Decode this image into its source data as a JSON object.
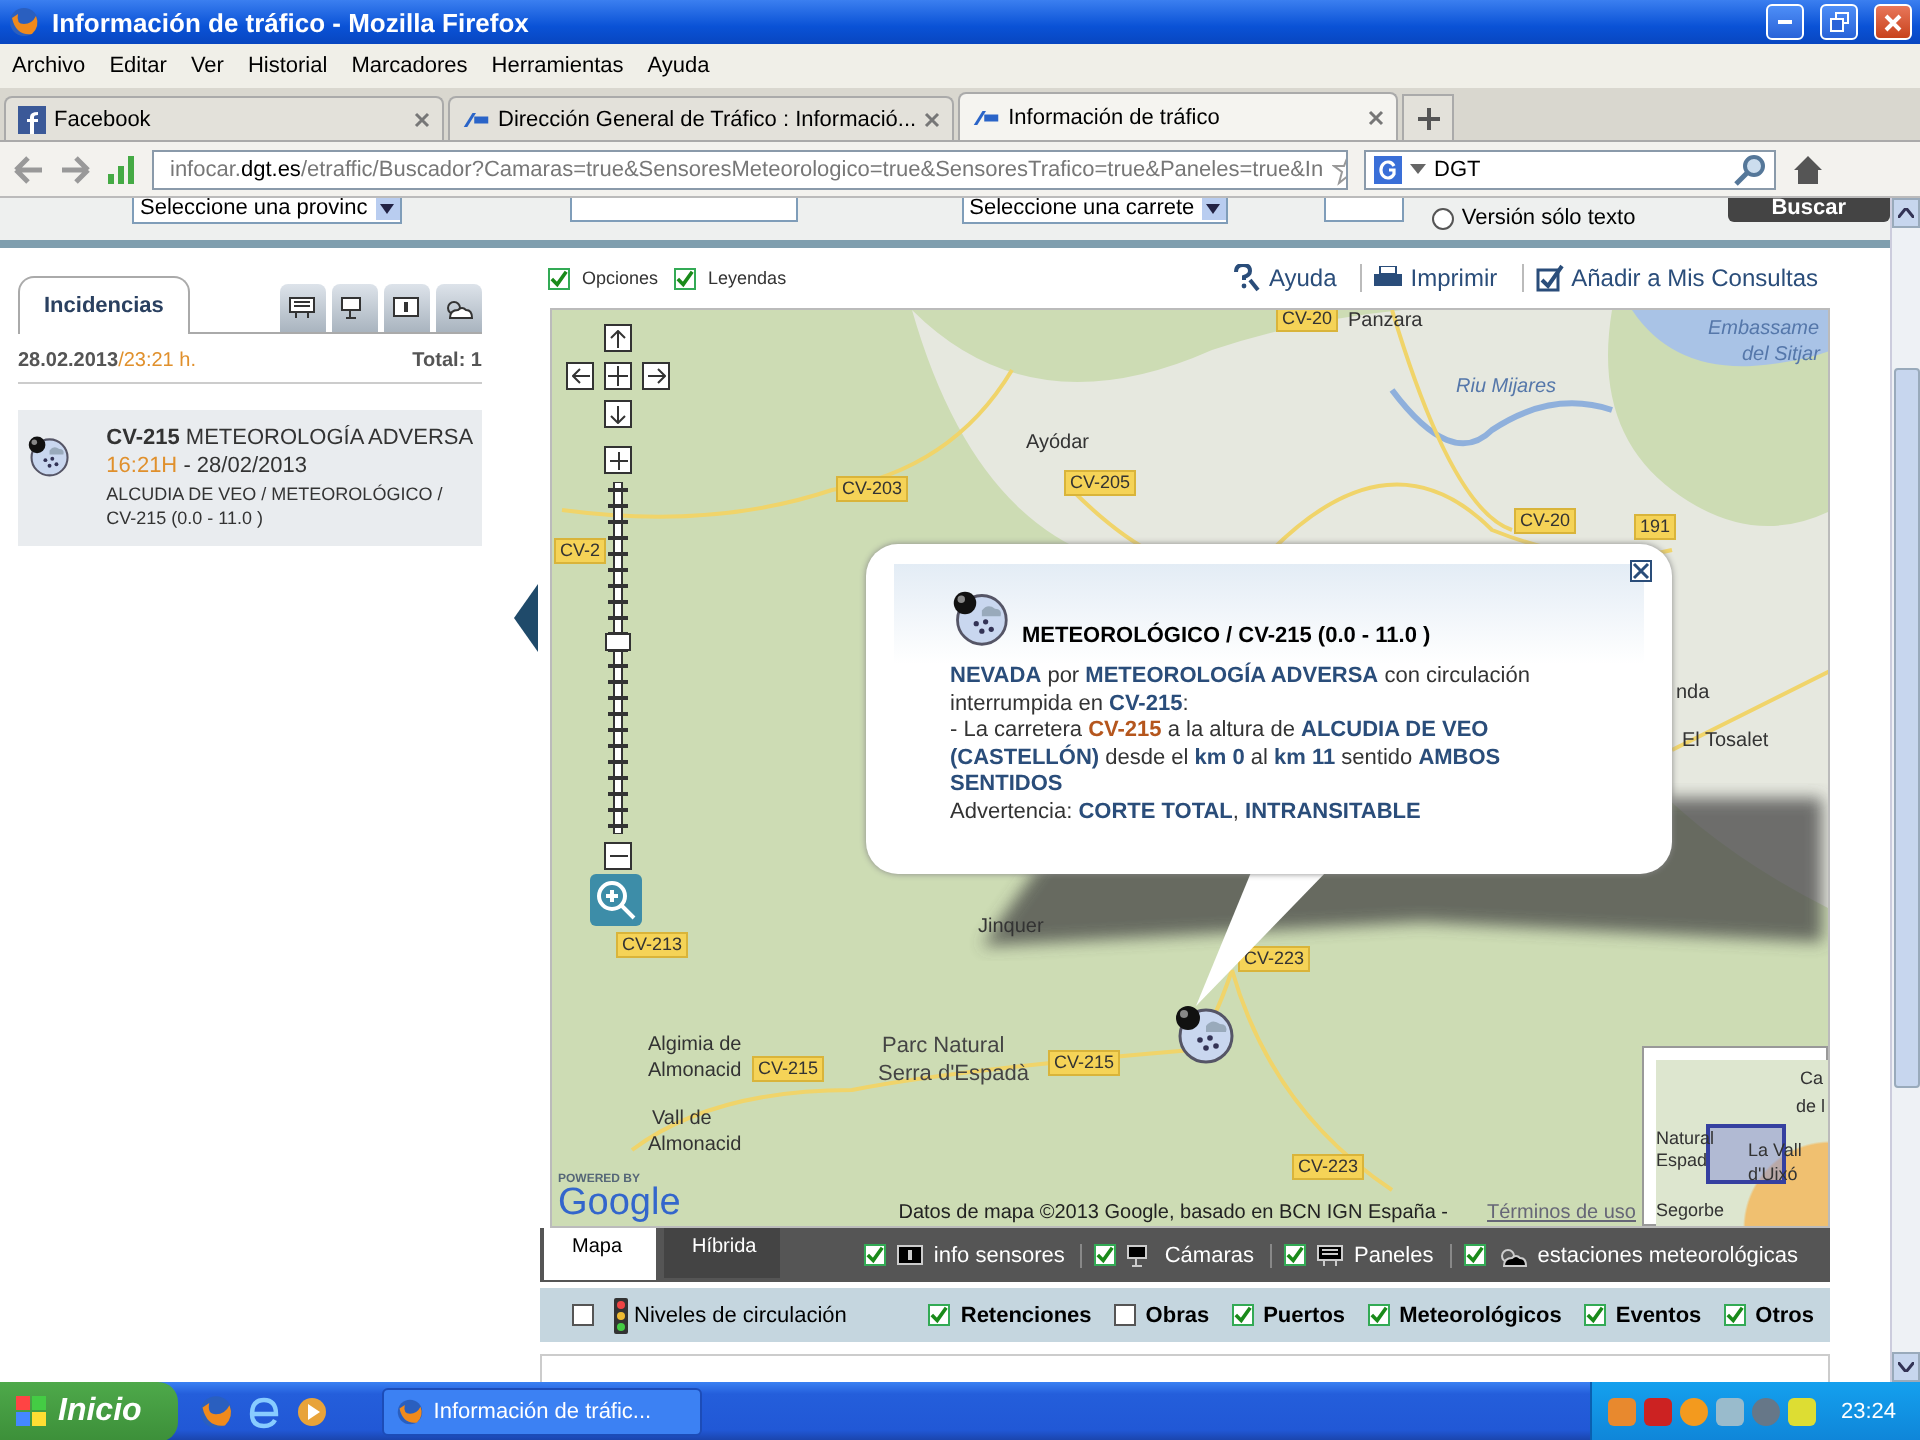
{
  "window": {
    "title": "Información de tráfico - Mozilla Firefox"
  },
  "menu": [
    "Archivo",
    "Editar",
    "Ver",
    "Historial",
    "Marcadores",
    "Herramientas",
    "Ayuda"
  ],
  "browser_tabs": [
    {
      "label": "Facebook",
      "selected": false,
      "kind": "facebook"
    },
    {
      "label": "Dirección General de Tráfico : Informació...",
      "selected": false,
      "kind": "dgt"
    },
    {
      "label": "Información de tráfico",
      "selected": true,
      "kind": "dgt"
    }
  ],
  "address_bar": {
    "host": "infocar.",
    "domain": "dgt.es",
    "path": "/etraffic/Buscador?Camaras=true&SensoresMeteorologico=true&SensoresTrafico=true&Paneles=true&In"
  },
  "search_bar": {
    "value": "DGT"
  },
  "search_form": {
    "province": "Seleccione una provinc",
    "road": "Seleccione una carrete",
    "text_only": {
      "label": "Versión sólo texto",
      "selected": false
    },
    "submit": "Buscar"
  },
  "side_panel": {
    "tabs": [
      {
        "label": "Incidencias",
        "selected": true,
        "kind": "text"
      },
      {
        "kind": "panel",
        "selected": false
      },
      {
        "kind": "camera",
        "selected": false
      },
      {
        "kind": "info",
        "selected": false
      },
      {
        "kind": "weather",
        "selected": false
      }
    ],
    "date": "28.02.2013",
    "time": " /23:21 h.",
    "total": "Total: 1",
    "incidents": [
      {
        "title": "**CV-215** METEOROLOGÍA ADVERSA",
        "time": "16:21H",
        "date": " - 28/02/2013",
        "location": "ALCUDIA DE VEO / METEOROLÓGICO / CV-215 (0.0 - 11.0 )"
      }
    ]
  },
  "options": [
    {
      "label": "Opciones",
      "checked": true
    },
    {
      "label": "Leyendas",
      "checked": true
    }
  ],
  "links": [
    {
      "label": "Ayuda",
      "kind": "help"
    },
    {
      "label": "Imprimir",
      "kind": "print"
    },
    {
      "label": "Añadir a Mis Consultas",
      "kind": "add"
    }
  ],
  "map": {
    "zoom": {
      "level": 0.55
    },
    "labels": [
      {
        "text": "CV-20",
        "kind": "road"
      },
      {
        "text": "Panzara",
        "kind": "place"
      },
      {
        "text": "Embassame",
        "kind": "water"
      },
      {
        "text": "del Sitjar",
        "kind": "water"
      },
      {
        "text": "Riu Mijares",
        "kind": "water"
      },
      {
        "text": "Ayódar",
        "kind": "place"
      },
      {
        "text": "CV-203",
        "kind": "road"
      },
      {
        "text": "CV-205",
        "kind": "road"
      },
      {
        "text": "CV-20",
        "kind": "road"
      },
      {
        "text": "CV-2",
        "kind": "road"
      },
      {
        "text": "191",
        "kind": "road"
      },
      {
        "text": "nda",
        "kind": "place"
      },
      {
        "text": "El Tosalet",
        "kind": "place"
      },
      {
        "text": "Jinquer",
        "kind": "place"
      },
      {
        "text": "CV-213",
        "kind": "road"
      },
      {
        "text": "CV-223",
        "kind": "road"
      },
      {
        "text": "Algimia de",
        "kind": "place"
      },
      {
        "text": "Almonacid",
        "kind": "place"
      },
      {
        "text": "CV-215",
        "kind": "road"
      },
      {
        "text": "Parc Natural",
        "kind": "park"
      },
      {
        "text": "Serra d'Espadà",
        "kind": "park"
      },
      {
        "text": "CV-215",
        "kind": "road"
      },
      {
        "text": "Vall de",
        "kind": "place"
      },
      {
        "text": "Almonacid",
        "kind": "place"
      },
      {
        "text": "CV-223",
        "kind": "road"
      }
    ],
    "minimap_labels": [
      "Ca",
      "de l",
      "Natural",
      "Espad",
      "La Vall",
      "d'Uixó",
      "Segorbe"
    ],
    "powered_by": "POWERED BY",
    "logo": "Google",
    "attribution": "Datos de mapa ©2013 Google, basado en BCN IGN España - ",
    "terms": "Términos de uso",
    "popup": {
      "title": "METEOROLÓGICO / CV-215 (0.0 - 11.0 )",
      "lines": [
        [
          {
            "t": "NEVADA",
            "kind": "bold"
          },
          {
            "t": " por ",
            "kind": "plain"
          },
          {
            "t": "METEOROLOGÍA ADVERSA",
            "kind": "bold"
          },
          {
            "t": " con circulación interrumpida en ",
            "kind": "plain"
          },
          {
            "t": "CV-215",
            "kind": "bold"
          },
          {
            "t": ":",
            "kind": "plain"
          }
        ],
        [
          {
            "t": "- La carretera ",
            "kind": "plain"
          },
          {
            "t": "CV-215",
            "kind": "road"
          },
          {
            "t": " a la altura de ",
            "kind": "plain"
          },
          {
            "t": "ALCUDIA DE VEO (CASTELLÓN)",
            "kind": "bold"
          },
          {
            "t": " desde el ",
            "kind": "plain"
          },
          {
            "t": "km 0",
            "kind": "bold"
          },
          {
            "t": " al ",
            "kind": "plain"
          },
          {
            "t": "km 11",
            "kind": "bold"
          },
          {
            "t": " sentido ",
            "kind": "plain"
          },
          {
            "t": "AMBOS SENTIDOS",
            "kind": "bold"
          }
        ],
        [
          {
            "t": "Advertencia: ",
            "kind": "plain"
          },
          {
            "t": "CORTE TOTAL",
            "kind": "bold"
          },
          {
            "t": ", ",
            "kind": "plain"
          },
          {
            "t": "INTRANSITABLE",
            "kind": "bold"
          }
        ]
      ]
    }
  },
  "map_types": [
    {
      "label": "Mapa",
      "selected": true
    },
    {
      "label": "Híbrida",
      "selected": false
    }
  ],
  "layers": [
    {
      "label": "info sensores",
      "checked": true,
      "kind": "info"
    },
    {
      "label": "Cámaras",
      "checked": true,
      "kind": "camera"
    },
    {
      "label": "Paneles",
      "checked": true,
      "kind": "panel"
    },
    {
      "label": "estaciones meteorológicas",
      "checked": true,
      "kind": "weather"
    }
  ],
  "traffic_levels": {
    "label": "Niveles de circulación",
    "checked": false
  },
  "filters": [
    {
      "label": "Retenciones",
      "checked": true
    },
    {
      "label": "Obras",
      "checked": false
    },
    {
      "label": "Puertos",
      "checked": true
    },
    {
      "label": "Meteorológicos",
      "checked": true
    },
    {
      "label": "Eventos",
      "checked": true
    },
    {
      "label": "Otros",
      "checked": true
    }
  ],
  "taskbar": {
    "start": "Inicio",
    "tasks": [
      {
        "label": "Información de tráfic...",
        "selected": false
      }
    ],
    "clock": "23:24"
  }
}
